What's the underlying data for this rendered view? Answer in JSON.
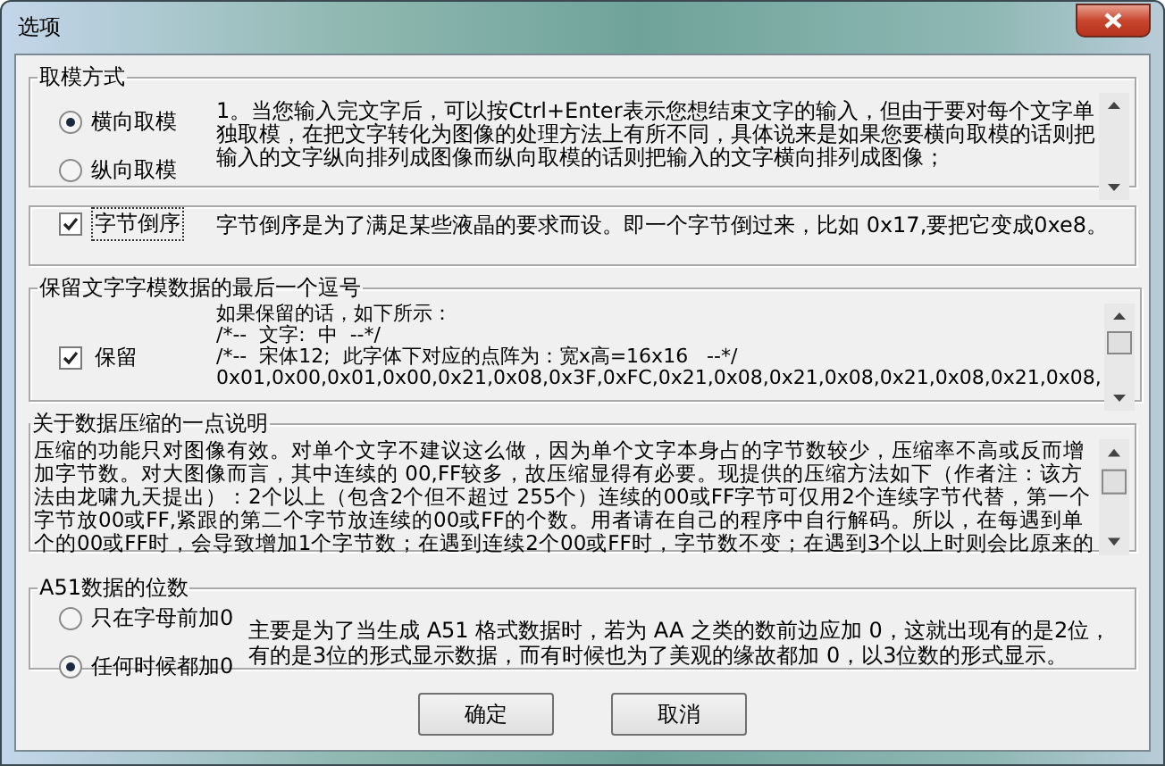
{
  "window": {
    "title": "选项"
  },
  "sections": [
    {
      "kind": "radio-memo",
      "title": "取模方式",
      "options": [
        {
          "label": "横向取模",
          "selected": true
        },
        {
          "label": "纵向取模",
          "selected": false
        }
      ],
      "text": "1。当您输入完文字后，可以按Ctrl+Enter表示您想结束文字的输入，但由于要对每个文字单独取模，在把文字转化为图像的处理方法上有所不同，具体说来是如果您要横向取模的话则把输入的文字纵向排列成图像而纵向取模的话则把输入的文字横向排列成图像；"
    },
    {
      "kind": "check-label",
      "label": "字节倒序",
      "checked": true,
      "text": "字节倒序是为了满足某些液晶的要求而设。即一个字节倒过来，比如 0x17,要把它变成0xe8。"
    },
    {
      "kind": "check-lines",
      "title": "保留文字字模数据的最后一个逗号",
      "label": "保留",
      "checked": true,
      "lines": [
        "如果保留的话，如下所示：",
        "/*--  文字:  中  --*/",
        "/*--  宋体12;  此字体下对应的点阵为：宽x高=16x16   --*/",
        "0x01,0x00,0x01,0x00,0x21,0x08,0x3F,0xFC,0x21,0x08,0x21,0x08,0x21,0x08,0x21,0x08,"
      ]
    },
    {
      "kind": "memo",
      "title": "关于数据压缩的一点说明",
      "text": "压缩的功能只对图像有效。对单个文字不建议这么做，因为单个文字本身占的字节数较少，压缩率不高或反而增加字节数。对大图像而言，其中连续的 00,FF较多，故压缩显得有必要。现提供的压缩方法如下（作者注：该方法由龙啸九天提出）：2个以上（包含2个但不超过 255个）连续的00或FF字节可仅用2个连续字节代替，第一个字节放00或FF,紧跟的第二个字节放连续的00或FF的个数。用者请在自己的程序中自行解码。所以，在每遇到单个的00或FF时，会导致增加1个字节数；在遇到连续2个00或FF时，字节数不变；在遇到3个以上时则会比原来的"
    },
    {
      "kind": "radio-label",
      "title": "A51数据的位数",
      "options": [
        {
          "label": "只在字母前加0",
          "selected": false
        },
        {
          "label": "任何时候都加0",
          "selected": true
        }
      ],
      "text": "主要是为了当生成 A51 格式数据时，若为 AA 之类的数前边应加 0，这就出现有的是2位，有的是3位的形式显示数据，而有时候也为了美观的缘故都加 0，以3位数的形式显示。"
    }
  ],
  "buttons": [
    "确定",
    "取消"
  ]
}
